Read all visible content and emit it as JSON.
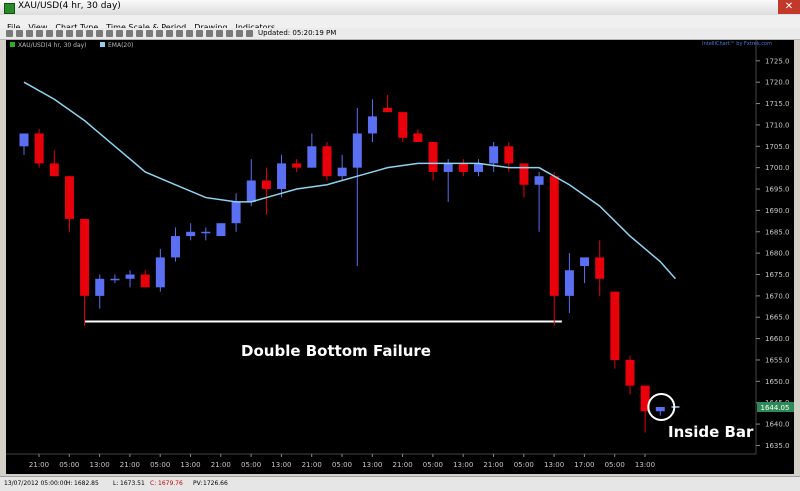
{
  "window": {
    "title": "XAU/USD(4 hr,  30 day)",
    "close_label": "✕"
  },
  "menu": [
    "File",
    "View",
    "Chart Type",
    "Time Scale & Period",
    "Drawing",
    "Indicators"
  ],
  "toolbar": {
    "updated": "Updated: 05:20:19 PM"
  },
  "legend": {
    "symbol": "XAU/USD(4 hr,  30 day)",
    "ema": "EMA(20)"
  },
  "brand": "IntelliChart™ by Fxtrek.com",
  "annotations": {
    "pattern": "Double Bottom Failure",
    "inside_bar": "Inside Bar"
  },
  "price_tag": "1644.05",
  "status": {
    "datetime": "13/07/2012 05:00:00",
    "high_label": "H:",
    "high": "1682.85",
    "low_label": "L:",
    "low": "1673.51",
    "close_label": "C:",
    "close": "1679.76",
    "pv_label": "PV:",
    "pv": "1726.66"
  },
  "colors": {
    "bull": "#5b6ff2",
    "bear": "#e8000b",
    "ema": "#8fd3f0",
    "support": "#ffffff",
    "background": "#000000"
  },
  "chart_data": {
    "type": "candlestick",
    "y_ticks": [
      1635,
      1640,
      1645,
      1650,
      1655,
      1660,
      1665,
      1670,
      1675,
      1680,
      1685,
      1690,
      1695,
      1700,
      1705,
      1710,
      1715,
      1720,
      1725
    ],
    "ylim": [
      1633,
      1728
    ],
    "x_tick_labels": [
      "21:00",
      "05:00",
      "13:00",
      "21:00",
      "05:00",
      "13:00",
      "21:00",
      "05:00",
      "13:00",
      "21:00",
      "05:00",
      "13:00",
      "21:00",
      "05:00",
      "13:00",
      "21:00",
      "05:00",
      "13:00",
      "17:00",
      "05:00",
      "13:00"
    ],
    "candles": [
      {
        "o": 1705,
        "h": 1708,
        "l": 1703,
        "c": 1708
      },
      {
        "o": 1708,
        "h": 1709,
        "l": 1700,
        "c": 1701
      },
      {
        "o": 1701,
        "h": 1704,
        "l": 1698,
        "c": 1698
      },
      {
        "o": 1698,
        "h": 1698,
        "l": 1685,
        "c": 1688
      },
      {
        "o": 1688,
        "h": 1688,
        "l": 1663,
        "c": 1670
      },
      {
        "o": 1670,
        "h": 1675,
        "l": 1667,
        "c": 1674
      },
      {
        "o": 1674,
        "h": 1675,
        "l": 1673,
        "c": 1674
      },
      {
        "o": 1674,
        "h": 1676,
        "l": 1672,
        "c": 1675
      },
      {
        "o": 1675,
        "h": 1676,
        "l": 1672,
        "c": 1672
      },
      {
        "o": 1672,
        "h": 1681,
        "l": 1671,
        "c": 1679
      },
      {
        "o": 1679,
        "h": 1686,
        "l": 1678,
        "c": 1684
      },
      {
        "o": 1684,
        "h": 1687,
        "l": 1683,
        "c": 1685
      },
      {
        "o": 1685,
        "h": 1686,
        "l": 1683,
        "c": 1685
      },
      {
        "o": 1684,
        "h": 1687,
        "l": 1684,
        "c": 1687
      },
      {
        "o": 1687,
        "h": 1694,
        "l": 1685,
        "c": 1692
      },
      {
        "o": 1692,
        "h": 1702,
        "l": 1691,
        "c": 1697
      },
      {
        "o": 1697,
        "h": 1700,
        "l": 1689,
        "c": 1695
      },
      {
        "o": 1695,
        "h": 1703,
        "l": 1693,
        "c": 1701
      },
      {
        "o": 1701,
        "h": 1702,
        "l": 1699,
        "c": 1700
      },
      {
        "o": 1700,
        "h": 1708,
        "l": 1700,
        "c": 1705
      },
      {
        "o": 1705,
        "h": 1706,
        "l": 1697,
        "c": 1698
      },
      {
        "o": 1698,
        "h": 1703,
        "l": 1697,
        "c": 1700
      },
      {
        "o": 1700,
        "h": 1714,
        "l": 1677,
        "c": 1708
      },
      {
        "o": 1708,
        "h": 1716,
        "l": 1706,
        "c": 1712
      },
      {
        "o": 1714,
        "h": 1717,
        "l": 1713,
        "c": 1713
      },
      {
        "o": 1713,
        "h": 1713,
        "l": 1706,
        "c": 1707
      },
      {
        "o": 1708,
        "h": 1709,
        "l": 1706,
        "c": 1706
      },
      {
        "o": 1706,
        "h": 1706,
        "l": 1697,
        "c": 1699
      },
      {
        "o": 1699,
        "h": 1702,
        "l": 1692,
        "c": 1701
      },
      {
        "o": 1701,
        "h": 1702,
        "l": 1698,
        "c": 1699
      },
      {
        "o": 1699,
        "h": 1702,
        "l": 1698,
        "c": 1701
      },
      {
        "o": 1701,
        "h": 1706,
        "l": 1699,
        "c": 1705
      },
      {
        "o": 1705,
        "h": 1706,
        "l": 1699,
        "c": 1701
      },
      {
        "o": 1701,
        "h": 1701,
        "l": 1693,
        "c": 1696
      },
      {
        "o": 1696,
        "h": 1699,
        "l": 1685,
        "c": 1698
      },
      {
        "o": 1698,
        "h": 1699,
        "l": 1663,
        "c": 1670
      },
      {
        "o": 1670,
        "h": 1680,
        "l": 1666,
        "c": 1676
      },
      {
        "o": 1677,
        "h": 1679,
        "l": 1673,
        "c": 1679
      },
      {
        "o": 1679,
        "h": 1683,
        "l": 1670,
        "c": 1674
      },
      {
        "o": 1671,
        "h": 1671,
        "l": 1653,
        "c": 1655
      },
      {
        "o": 1655,
        "h": 1656,
        "l": 1647,
        "c": 1649
      },
      {
        "o": 1649,
        "h": 1649,
        "l": 1638,
        "c": 1643
      },
      {
        "o": 1643,
        "h": 1644,
        "l": 1642,
        "c": 1644
      },
      {
        "o": 1644,
        "h": 1644,
        "l": 1644,
        "c": 1644
      }
    ],
    "ema20": [
      [
        0,
        1720
      ],
      [
        2,
        1716
      ],
      [
        4,
        1711
      ],
      [
        6,
        1705
      ],
      [
        8,
        1699
      ],
      [
        10,
        1696
      ],
      [
        12,
        1693
      ],
      [
        14,
        1692
      ],
      [
        15,
        1692
      ],
      [
        16,
        1693
      ],
      [
        18,
        1695
      ],
      [
        20,
        1696
      ],
      [
        22,
        1698
      ],
      [
        24,
        1700
      ],
      [
        26,
        1701
      ],
      [
        28,
        1701
      ],
      [
        30,
        1701
      ],
      [
        32,
        1700
      ],
      [
        34,
        1700
      ],
      [
        36,
        1696
      ],
      [
        38,
        1691
      ],
      [
        40,
        1684
      ],
      [
        42,
        1678
      ],
      [
        43,
        1674
      ]
    ],
    "support_level": 1664,
    "support_range": [
      4,
      35.5
    ],
    "inside_bar_index": 42
  }
}
